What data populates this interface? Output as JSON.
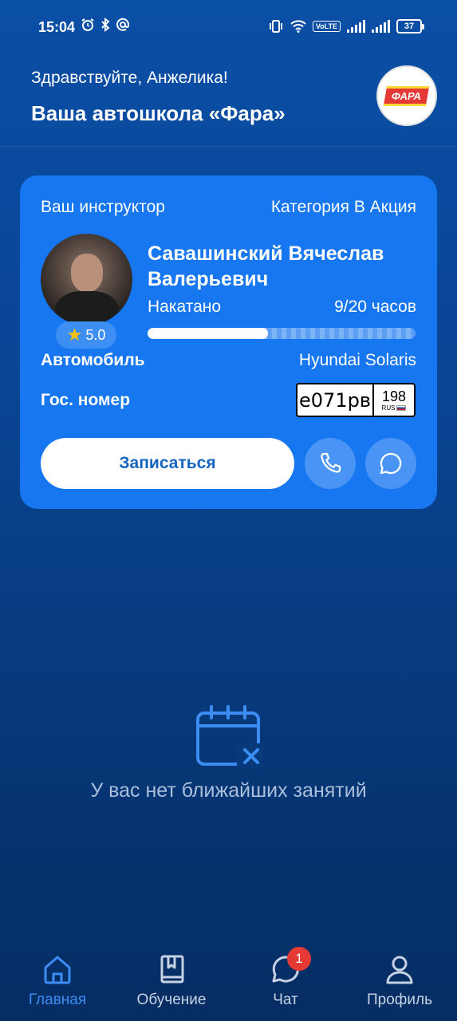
{
  "status_bar": {
    "time": "15:04",
    "left_icons": [
      "alarm-icon",
      "bluetooth-icon",
      "at-icon"
    ],
    "volte": "VoLTE",
    "battery": "37"
  },
  "header": {
    "greeting": "Здравствуйте, Анжелика!",
    "school": "Ваша автошкола «Фара»",
    "logo_text": "ФАРА"
  },
  "card": {
    "instructor_label": "Ваш инструктор",
    "category": "Категория В Акция",
    "instructor_name": "Савашинский Вячеслав Валерьевич",
    "rating": "5.0",
    "driven_label": "Накатано",
    "driven_value": "9/20 часов",
    "driven_fraction": 0.45,
    "car_label": "Автомобиль",
    "car_value": "Hyundai Solaris",
    "plate_label": "Гос. номер",
    "plate_main": "е071рв",
    "plate_region": "198",
    "plate_country": "RUS",
    "signup_button": "Записаться"
  },
  "empty_state": {
    "text": "У вас нет ближайших занятий"
  },
  "nav": {
    "items": [
      {
        "label": "Главная",
        "icon": "home-icon",
        "active": true
      },
      {
        "label": "Обучение",
        "icon": "book-icon",
        "active": false
      },
      {
        "label": "Чат",
        "icon": "chat-icon",
        "active": false,
        "badge": "1"
      },
      {
        "label": "Профиль",
        "icon": "profile-icon",
        "active": false
      }
    ]
  },
  "colors": {
    "background": "#0a4596",
    "card": "#1777f0",
    "accent": "#3c8df3",
    "badge": "#e53935"
  }
}
